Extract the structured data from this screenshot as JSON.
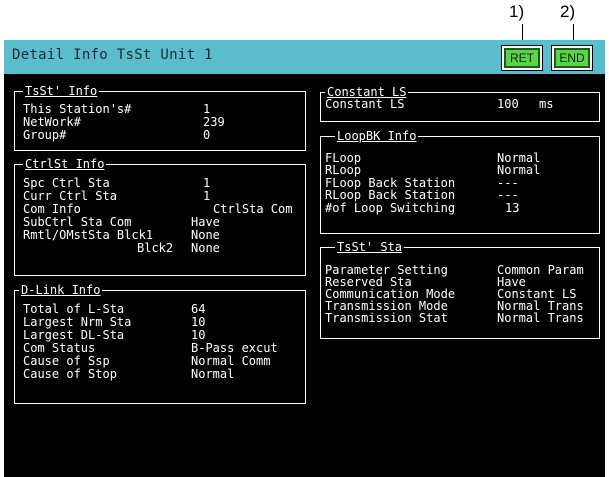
{
  "callouts": [
    "1)",
    "2)"
  ],
  "titlebar": {
    "title": "Detail Info TsSt Unit  1"
  },
  "buttons": {
    "ret": "RET",
    "end": "END"
  },
  "colors": {
    "titlebar": "#5bbccb",
    "button": "#5bd44a",
    "screen": "#000000"
  },
  "tsst_info": {
    "title": "TsSt' Info",
    "rows": [
      {
        "label": "This Station's#",
        "value": "1"
      },
      {
        "label": "NetWork#",
        "value": "239"
      },
      {
        "label": "Group#",
        "value": "0"
      }
    ]
  },
  "ctrlst_info": {
    "title": "CtrlSt Info",
    "rows": [
      {
        "label": "Spc Ctrl Sta",
        "value": "1"
      },
      {
        "label": "Curr Ctrl Sta",
        "value": "1"
      },
      {
        "label": "Com Info",
        "value": "CtrlSta Com"
      },
      {
        "label": "SubCtrl Sta Com",
        "value": "Have"
      },
      {
        "label": "Rmtl/OMstSta Blck1",
        "value": "None"
      },
      {
        "label": "Blck2",
        "value": "None"
      }
    ]
  },
  "dlink_info": {
    "title": "D-Link Info",
    "rows": [
      {
        "label": "Total of L-Sta",
        "value": "64"
      },
      {
        "label": "Largest Nrm Sta",
        "value": "10"
      },
      {
        "label": "Largest DL-Sta",
        "value": "10"
      },
      {
        "label": "Com Status",
        "value": "B-Pass excut"
      },
      {
        "label": "Cause of Ssp",
        "value": "Normal Comm"
      },
      {
        "label": "Cause of Stop",
        "value": "Normal"
      }
    ]
  },
  "constant_ls": {
    "title": "Constant LS",
    "rows": [
      {
        "label": "Constant LS",
        "value": "100",
        "unit": "ms"
      }
    ]
  },
  "loopbk_info": {
    "title": "LoopBK Info",
    "rows": [
      {
        "label": "FLoop",
        "value": "Normal"
      },
      {
        "label": "RLoop",
        "value": "Normal"
      },
      {
        "label": "FLoop Back Station",
        "value": "---"
      },
      {
        "label": "RLoop Back Station",
        "value": "---"
      },
      {
        "label": "#of Loop Switching",
        "value": "13"
      }
    ]
  },
  "tsst_sta": {
    "title": "TsSt' Sta",
    "rows": [
      {
        "label": "Parameter Setting",
        "value": "Common Param"
      },
      {
        "label": "Reserved Sta",
        "value": "Have"
      },
      {
        "label": "Communication Mode",
        "value": "Constant LS"
      },
      {
        "label": "Transmission Mode",
        "value": "Normal Trans"
      },
      {
        "label": "Transmission Stat",
        "value": "Normal Trans"
      }
    ]
  }
}
